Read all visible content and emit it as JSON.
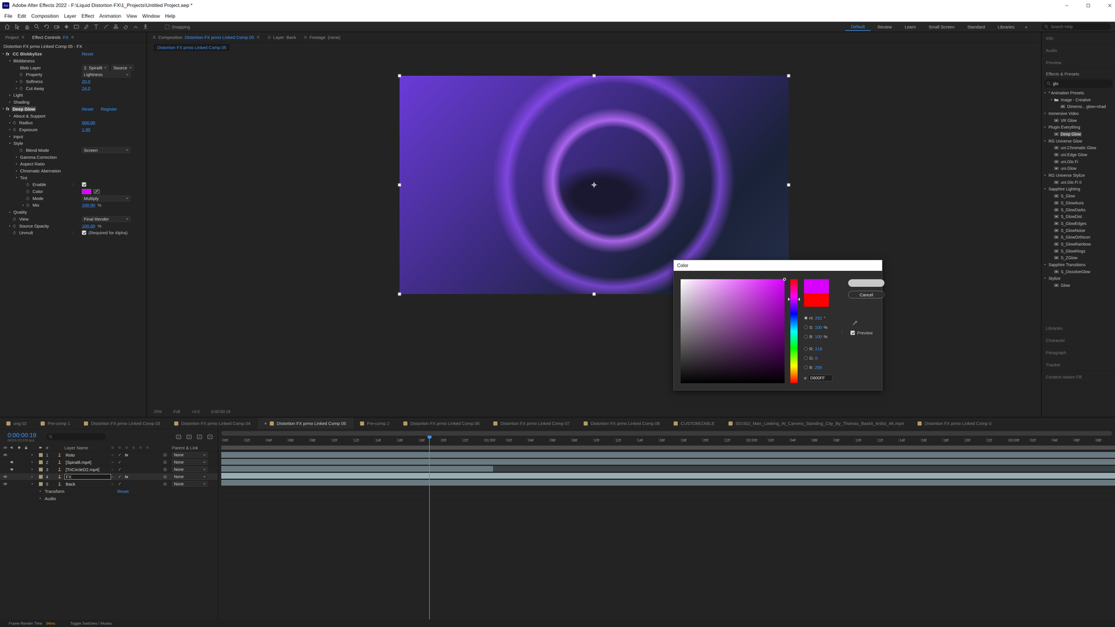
{
  "window": {
    "app_icon": "Ae",
    "title": "Adobe After Effects 2022 - F:\\Liquid Distortion FX\\1_Projects\\Untitled Project.aep *"
  },
  "menu": [
    "File",
    "Edit",
    "Composition",
    "Layer",
    "Effect",
    "Animation",
    "View",
    "Window",
    "Help"
  ],
  "toolbar": {
    "snapping": {
      "label": "Snapping",
      "checked": false
    },
    "workspaces": [
      {
        "label": "Default",
        "selected": true
      },
      {
        "label": "Review",
        "selected": false
      },
      {
        "label": "Learn",
        "selected": false
      },
      {
        "label": "Small Screen",
        "selected": false
      },
      {
        "label": "Standard",
        "selected": false
      },
      {
        "label": "Libraries",
        "selected": false
      }
    ],
    "overflow": "»",
    "search": {
      "placeholder": "Search Help"
    }
  },
  "effect_controls": {
    "tabs": [
      {
        "label": "Project",
        "target": "",
        "selected": false
      },
      {
        "label": "Effect Controls",
        "target": "FX",
        "selected": true
      }
    ],
    "header": "Distortion FX prmo Linked Comp 05 - FX",
    "rows": [
      {
        "kind": "effect",
        "label": "CC Blobbylize",
        "fx": "fx",
        "depth": 0,
        "twisty": "open",
        "stopwatch": false,
        "links": [
          "Reset"
        ],
        "selected": false
      },
      {
        "kind": "group",
        "label": "Blobbiness",
        "depth": 1,
        "twisty": "open",
        "stopwatch": false
      },
      {
        "kind": "layer",
        "label": "Blob Layer",
        "depth": 2,
        "twisty": "none",
        "stopwatch": false,
        "value": "2. Spiral8",
        "source": "Source"
      },
      {
        "kind": "dropdown",
        "label": "Property",
        "depth": 2,
        "twisty": "none",
        "stopwatch": true,
        "value": "Lightness"
      },
      {
        "kind": "number",
        "label": "Softness",
        "depth": 2,
        "twisty": "closed",
        "stopwatch": true,
        "value": "20.0",
        "unit": ""
      },
      {
        "kind": "number",
        "label": "Cut Away",
        "depth": 2,
        "twisty": "closed",
        "stopwatch": true,
        "value": "24.0",
        "unit": ""
      },
      {
        "kind": "group",
        "label": "Light",
        "depth": 1,
        "twisty": "closed",
        "stopwatch": false
      },
      {
        "kind": "group",
        "label": "Shading",
        "depth": 1,
        "twisty": "closed",
        "stopwatch": false
      },
      {
        "kind": "effect",
        "label": "Deep Glow",
        "fx": "fx",
        "depth": 0,
        "twisty": "open",
        "stopwatch": false,
        "links": [
          "Reset",
          "Register"
        ],
        "selected": true
      },
      {
        "kind": "group",
        "label": "About & Support",
        "depth": 1,
        "twisty": "closed",
        "stopwatch": false
      },
      {
        "kind": "number",
        "label": "Radius",
        "depth": 1,
        "twisty": "closed",
        "stopwatch": true,
        "value": "500.00",
        "unit": ""
      },
      {
        "kind": "number",
        "label": "Exposure",
        "depth": 1,
        "twisty": "closed",
        "stopwatch": true,
        "value": "1.00",
        "unit": ""
      },
      {
        "kind": "group",
        "label": "Input",
        "depth": 1,
        "twisty": "closed",
        "stopwatch": false
      },
      {
        "kind": "group",
        "label": "Style",
        "depth": 1,
        "twisty": "open",
        "stopwatch": false
      },
      {
        "kind": "dropdown",
        "label": "Blend Mode",
        "depth": 2,
        "twisty": "none",
        "stopwatch": true,
        "value": "Screen"
      },
      {
        "kind": "group",
        "label": "Gamma Correction",
        "depth": 2,
        "twisty": "closed",
        "stopwatch": false
      },
      {
        "kind": "group",
        "label": "Aspect Ratio",
        "depth": 2,
        "twisty": "closed",
        "stopwatch": false
      },
      {
        "kind": "group",
        "label": "Chromatic Aberration",
        "depth": 2,
        "twisty": "closed",
        "stopwatch": false
      },
      {
        "kind": "group",
        "label": "Tint",
        "depth": 2,
        "twisty": "open",
        "stopwatch": false
      },
      {
        "kind": "checkbox",
        "label": "Enable",
        "depth": 3,
        "twisty": "none",
        "stopwatch": true,
        "checked": true,
        "note": ""
      },
      {
        "kind": "color",
        "label": "Color",
        "depth": 3,
        "twisty": "none",
        "stopwatch": true,
        "color": "#D800FF"
      },
      {
        "kind": "dropdown",
        "label": "Mode",
        "depth": 3,
        "twisty": "none",
        "stopwatch": true,
        "value": "Multiply"
      },
      {
        "kind": "number",
        "label": "Mix",
        "depth": 3,
        "twisty": "closed",
        "stopwatch": true,
        "value": "100.00",
        "unit": "%"
      },
      {
        "kind": "group",
        "label": "Quality",
        "depth": 1,
        "twisty": "closed",
        "stopwatch": false
      },
      {
        "kind": "dropdown",
        "label": "View",
        "depth": 1,
        "twisty": "none",
        "stopwatch": true,
        "value": "Final Render"
      },
      {
        "kind": "number",
        "label": "Source Opacity",
        "depth": 1,
        "twisty": "closed",
        "stopwatch": true,
        "value": "100.00",
        "unit": "%"
      },
      {
        "kind": "checkbox",
        "label": "Unmult",
        "depth": 1,
        "twisty": "none",
        "stopwatch": true,
        "checked": true,
        "note": "(Required for Alpha)"
      }
    ]
  },
  "composition": {
    "tabs": [
      {
        "label": "Composition",
        "target": "Distortion FX prmo Linked Comp 05",
        "selected": true
      },
      {
        "label": "Layer",
        "target": "Back",
        "selected": false
      },
      {
        "label": "Footage",
        "target": "(none)",
        "selected": false
      }
    ],
    "breadcrumb": "Distortion FX prmo Linked Comp 05",
    "footer": [
      "25%",
      "Full",
      "+0.0",
      "0:00:00:19"
    ]
  },
  "color_dialog": {
    "title": "Color",
    "new_color": "#D800FF",
    "old_color": "#FF0000",
    "buttons": [
      {
        "label": "",
        "default": true
      },
      {
        "label": "Cancel",
        "default": false
      }
    ],
    "fields": [
      {
        "label": "H:",
        "value": "291",
        "unit": "°",
        "selected": true
      },
      {
        "label": "S:",
        "value": "100",
        "unit": "%",
        "selected": false
      },
      {
        "label": "B:",
        "value": "100",
        "unit": "%",
        "selected": false
      },
      {
        "label": "R:",
        "value": "216",
        "unit": "",
        "selected": false
      },
      {
        "label": "G:",
        "value": "0",
        "unit": "",
        "selected": false
      },
      {
        "label": "B:",
        "value": "255",
        "unit": "",
        "selected": false
      }
    ],
    "hex": {
      "label": "#",
      "value": "D800FF"
    },
    "preview": {
      "label": "Preview",
      "checked": true
    }
  },
  "effects_panel": {
    "top_panels": [
      "Info",
      "Audio",
      "Preview"
    ],
    "title": "Effects & Presets",
    "search": {
      "value": "glo"
    },
    "tree": [
      {
        "label": "* Animation Presets",
        "kind": "category",
        "depth": 0,
        "expanded": true,
        "selected": false
      },
      {
        "label": "Image - Creative",
        "kind": "folder",
        "depth": 1,
        "expanded": true,
        "selected": false
      },
      {
        "label": "Dimensi... glow+shad",
        "kind": "preset",
        "depth": 2,
        "expanded": false,
        "selected": false
      },
      {
        "label": "Immersive Video",
        "kind": "category",
        "depth": 0,
        "expanded": true,
        "selected": false
      },
      {
        "label": "VR Glow",
        "kind": "effect",
        "depth": 1,
        "expanded": false,
        "selected": false
      },
      {
        "label": "Plugin Everything",
        "kind": "category",
        "depth": 0,
        "expanded": true,
        "selected": false
      },
      {
        "label": "Deep Glow",
        "kind": "effect",
        "depth": 1,
        "expanded": false,
        "selected": true
      },
      {
        "label": "RG Universe Glow",
        "kind": "category",
        "depth": 0,
        "expanded": true,
        "selected": false
      },
      {
        "label": "uni.Chromatic Glow",
        "kind": "effect",
        "depth": 1,
        "expanded": false,
        "selected": false
      },
      {
        "label": "uni.Edge Glow",
        "kind": "effect",
        "depth": 1,
        "expanded": false,
        "selected": false
      },
      {
        "label": "uni.Glo Fi",
        "kind": "effect",
        "depth": 1,
        "expanded": false,
        "selected": false
      },
      {
        "label": "uni.Glow",
        "kind": "effect",
        "depth": 1,
        "expanded": false,
        "selected": false
      },
      {
        "label": "RG Universe Stylize",
        "kind": "category",
        "depth": 0,
        "expanded": true,
        "selected": false
      },
      {
        "label": "uni.Glo Fi II",
        "kind": "effect",
        "depth": 1,
        "expanded": false,
        "selected": false
      },
      {
        "label": "Sapphire Lighting",
        "kind": "category",
        "depth": 0,
        "expanded": true,
        "selected": false
      },
      {
        "label": "S_Glow",
        "kind": "effect",
        "depth": 1,
        "expanded": false,
        "selected": false
      },
      {
        "label": "S_GlowAura",
        "kind": "effect",
        "depth": 1,
        "expanded": false,
        "selected": false
      },
      {
        "label": "S_GlowDarks",
        "kind": "effect",
        "depth": 1,
        "expanded": false,
        "selected": false
      },
      {
        "label": "S_GlowDist",
        "kind": "effect",
        "depth": 1,
        "expanded": false,
        "selected": false
      },
      {
        "label": "S_GlowEdges",
        "kind": "effect",
        "depth": 1,
        "expanded": false,
        "selected": false
      },
      {
        "label": "S_GlowNoise",
        "kind": "effect",
        "depth": 1,
        "expanded": false,
        "selected": false
      },
      {
        "label": "S_GlowOrthicon",
        "kind": "effect",
        "depth": 1,
        "expanded": false,
        "selected": false
      },
      {
        "label": "S_GlowRainbow",
        "kind": "effect",
        "depth": 1,
        "expanded": false,
        "selected": false
      },
      {
        "label": "S_GlowRings",
        "kind": "effect",
        "depth": 1,
        "expanded": false,
        "selected": false
      },
      {
        "label": "S_ZGlow",
        "kind": "effect",
        "depth": 1,
        "expanded": false,
        "selected": false
      },
      {
        "label": "Sapphire Transitions",
        "kind": "category",
        "depth": 0,
        "expanded": true,
        "selected": false
      },
      {
        "label": "S_DissolveGlow",
        "kind": "effect",
        "depth": 1,
        "expanded": false,
        "selected": false
      },
      {
        "label": "Stylize",
        "kind": "category",
        "depth": 0,
        "expanded": true,
        "selected": false
      },
      {
        "label": "Glow",
        "kind": "effect",
        "depth": 1,
        "expanded": false,
        "selected": false
      }
    ],
    "bottom_panels": [
      "Libraries",
      "Character",
      "Paragraph",
      "Tracker",
      "Content-Aware Fill"
    ]
  },
  "timeline": {
    "tab_close": "×",
    "tabs": [
      {
        "label": "ung 02",
        "selected": false
      },
      {
        "label": "Pre-comp 1",
        "selected": false
      },
      {
        "label": "Distortion FX prmo Linked Comp 03",
        "selected": false
      },
      {
        "label": "Distortion FX prmo Linked Comp 04",
        "selected": false
      },
      {
        "label": "Distortion FX prmo Linked Comp 05",
        "selected": true
      },
      {
        "label": "Pre-comp 2",
        "selected": false
      },
      {
        "label": "Distortion FX prmo Linked Comp 06",
        "selected": false
      },
      {
        "label": "Distortion FX prmo Linked Comp 07",
        "selected": false
      },
      {
        "label": "Distortion FX prmo Linked Comp 08",
        "selected": false
      },
      {
        "label": "CUSTOMIZABLE",
        "selected": false
      },
      {
        "label": "S01502_Man_Looking_At_Camera_Standing_City_By_Thomas_Backit_Artlist_4K.mp4",
        "selected": false
      },
      {
        "label": "Distortion FX prmo Linked Comp 0",
        "selected": false
      }
    ],
    "timecode": "0:00:00:19",
    "timecode_sub": "00019 (23.976 fps)",
    "columns": {
      "index": "#",
      "name": "Layer Name",
      "parent": "Parent & Link"
    },
    "fx_badge": "fx",
    "layers": [
      {
        "index": "1",
        "name": "Roto",
        "video": true,
        "audio": false,
        "fx": true,
        "selected": false,
        "expanded": false,
        "parent": "None",
        "level": 1
      },
      {
        "index": "2",
        "name": "[Spiral8.mp4]",
        "video": false,
        "audio": true,
        "fx": false,
        "selected": false,
        "expanded": false,
        "parent": "None",
        "level": 1
      },
      {
        "index": "3",
        "name": "[TriCircleD2.mp4]",
        "video": false,
        "audio": true,
        "fx": false,
        "selected": false,
        "expanded": false,
        "parent": "None",
        "level": 0.304
      },
      {
        "index": "4",
        "name": "FX",
        "video": true,
        "audio": false,
        "fx": true,
        "selected": true,
        "expanded": false,
        "parent": "None",
        "level": 1
      },
      {
        "index": "5",
        "name": "Back",
        "video": true,
        "audio": false,
        "fx": false,
        "selected": false,
        "expanded": true,
        "parent": "None",
        "level": 1
      }
    ],
    "sub_rows": [
      {
        "label": "Transform",
        "link": "Reset"
      },
      {
        "label": "Audio",
        "link": ""
      }
    ],
    "ruler": [
      "00f",
      "02f",
      "04f",
      "06f",
      "08f",
      "10f",
      "12f",
      "14f",
      "16f",
      "18f",
      "20f",
      "22f",
      "01:00f",
      "02f",
      "04f",
      "06f",
      "08f",
      "10f",
      "12f",
      "14f",
      "16f",
      "18f",
      "20f",
      "22f",
      "02:00f",
      "02f",
      "04f",
      "06f",
      "08f",
      "10f",
      "12f",
      "14f",
      "16f",
      "18f",
      "20f",
      "22f",
      "03:00f",
      "02f",
      "04f",
      "06f",
      "08f"
    ],
    "status": [
      "Frame Render Time",
      "34ms",
      "Toggle Switches / Modes"
    ]
  }
}
